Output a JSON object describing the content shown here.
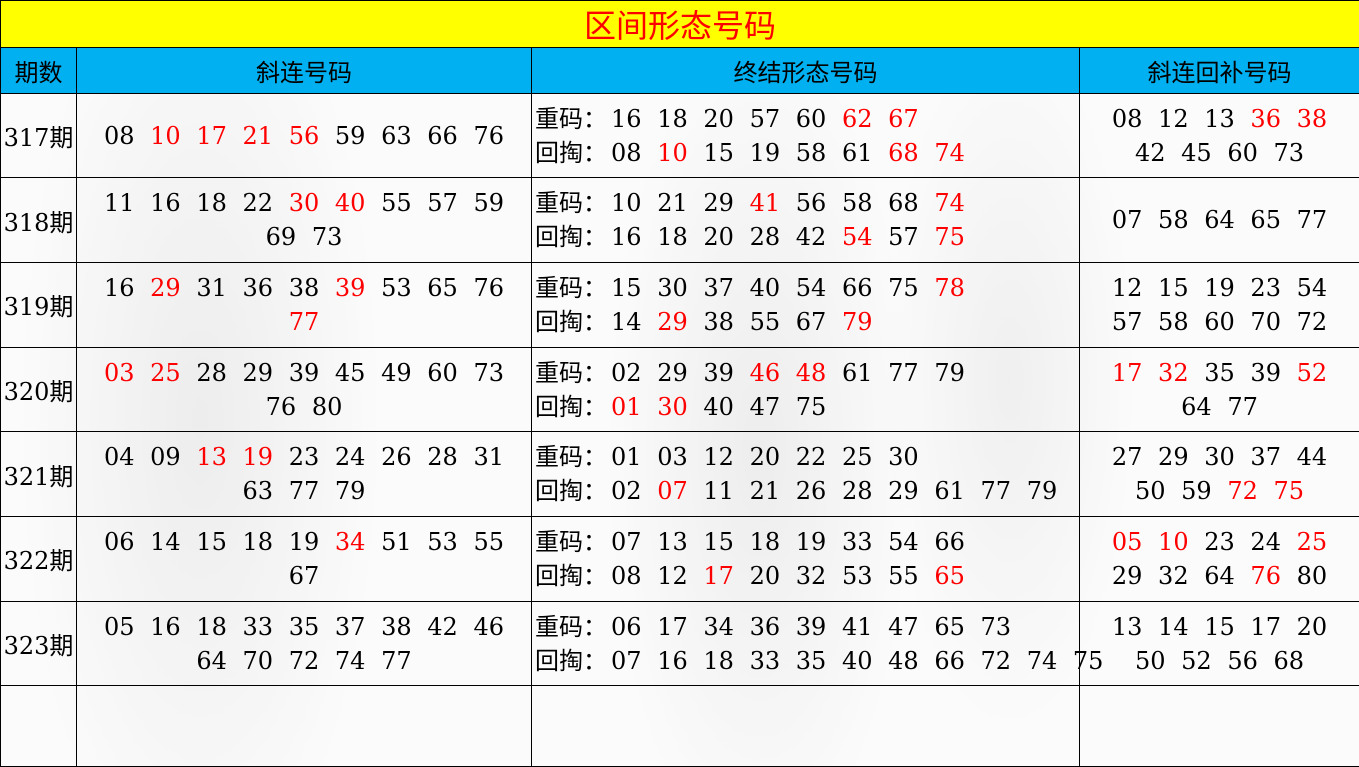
{
  "title": "区间形态号码",
  "headers": {
    "period": "期数",
    "diagonal": "斜连号码",
    "final": "终结形态号码",
    "supplement": "斜连回补号码"
  },
  "labels": {
    "repeat": "重码：",
    "fallback": "回掏："
  },
  "colors": {
    "title_bg": "#ffff00",
    "title_text": "#ff0000",
    "header_bg": "#00b0f0",
    "highlight": "#ff0000"
  },
  "rows": [
    {
      "period": "317期",
      "diagonal": [
        {
          "n": "08"
        },
        {
          "n": "10",
          "hot": true
        },
        {
          "n": "17",
          "hot": true
        },
        {
          "n": "21",
          "hot": true
        },
        {
          "n": "56",
          "hot": true
        },
        {
          "n": "59"
        },
        {
          "n": "63"
        },
        {
          "n": "66"
        },
        {
          "n": "76"
        }
      ],
      "repeat": [
        {
          "n": "16"
        },
        {
          "n": "18"
        },
        {
          "n": "20"
        },
        {
          "n": "57"
        },
        {
          "n": "60"
        },
        {
          "n": "62",
          "hot": true
        },
        {
          "n": "67",
          "hot": true
        }
      ],
      "fallback": [
        {
          "n": "08"
        },
        {
          "n": "10",
          "hot": true
        },
        {
          "n": "15"
        },
        {
          "n": "19"
        },
        {
          "n": "58"
        },
        {
          "n": "61"
        },
        {
          "n": "68",
          "hot": true
        },
        {
          "n": "74",
          "hot": true
        }
      ],
      "supplement": [
        {
          "n": "08"
        },
        {
          "n": "12"
        },
        {
          "n": "13"
        },
        {
          "n": "36",
          "hot": true
        },
        {
          "n": "38",
          "hot": true
        },
        {
          "n": "42"
        },
        {
          "n": "45"
        },
        {
          "n": "60"
        },
        {
          "n": "73"
        }
      ]
    },
    {
      "period": "318期",
      "diagonal": [
        {
          "n": "11"
        },
        {
          "n": "16"
        },
        {
          "n": "18"
        },
        {
          "n": "22"
        },
        {
          "n": "30",
          "hot": true
        },
        {
          "n": "40",
          "hot": true
        },
        {
          "n": "55"
        },
        {
          "n": "57"
        },
        {
          "n": "59"
        },
        {
          "n": "69"
        },
        {
          "n": "73"
        }
      ],
      "repeat": [
        {
          "n": "10"
        },
        {
          "n": "21"
        },
        {
          "n": "29"
        },
        {
          "n": "41",
          "hot": true
        },
        {
          "n": "56"
        },
        {
          "n": "58"
        },
        {
          "n": "68"
        },
        {
          "n": "74",
          "hot": true
        }
      ],
      "fallback": [
        {
          "n": "16"
        },
        {
          "n": "18"
        },
        {
          "n": "20"
        },
        {
          "n": "28"
        },
        {
          "n": "42"
        },
        {
          "n": "54",
          "hot": true
        },
        {
          "n": "57"
        },
        {
          "n": "75",
          "hot": true
        }
      ],
      "supplement": [
        {
          "n": "07"
        },
        {
          "n": "58"
        },
        {
          "n": "64"
        },
        {
          "n": "65"
        },
        {
          "n": "77"
        }
      ]
    },
    {
      "period": "319期",
      "diagonal": [
        {
          "n": "16"
        },
        {
          "n": "29",
          "hot": true
        },
        {
          "n": "31"
        },
        {
          "n": "36"
        },
        {
          "n": "38"
        },
        {
          "n": "39",
          "hot": true
        },
        {
          "n": "53"
        },
        {
          "n": "65"
        },
        {
          "n": "76"
        },
        {
          "n": "77",
          "hot": true
        }
      ],
      "repeat": [
        {
          "n": "15"
        },
        {
          "n": "30"
        },
        {
          "n": "37"
        },
        {
          "n": "40"
        },
        {
          "n": "54"
        },
        {
          "n": "66"
        },
        {
          "n": "75"
        },
        {
          "n": "78",
          "hot": true
        }
      ],
      "fallback": [
        {
          "n": "14"
        },
        {
          "n": "29",
          "hot": true
        },
        {
          "n": "38"
        },
        {
          "n": "55"
        },
        {
          "n": "67"
        },
        {
          "n": "79",
          "hot": true
        }
      ],
      "supplement": [
        {
          "n": "12"
        },
        {
          "n": "15"
        },
        {
          "n": "19"
        },
        {
          "n": "23"
        },
        {
          "n": "54"
        },
        {
          "n": "57"
        },
        {
          "n": "58"
        },
        {
          "n": "60"
        },
        {
          "n": "70"
        },
        {
          "n": "72"
        }
      ]
    },
    {
      "period": "320期",
      "diagonal": [
        {
          "n": "03",
          "hot": true
        },
        {
          "n": "25",
          "hot": true
        },
        {
          "n": "28"
        },
        {
          "n": "29"
        },
        {
          "n": "39"
        },
        {
          "n": "45"
        },
        {
          "n": "49"
        },
        {
          "n": "60"
        },
        {
          "n": "73"
        },
        {
          "n": "76"
        },
        {
          "n": "80"
        }
      ],
      "repeat": [
        {
          "n": "02"
        },
        {
          "n": "29"
        },
        {
          "n": "39"
        },
        {
          "n": "46",
          "hot": true
        },
        {
          "n": "48",
          "hot": true
        },
        {
          "n": "61"
        },
        {
          "n": "77"
        },
        {
          "n": "79"
        }
      ],
      "fallback": [
        {
          "n": "01",
          "hot": true
        },
        {
          "n": "30",
          "hot": true
        },
        {
          "n": "40"
        },
        {
          "n": "47"
        },
        {
          "n": "75"
        }
      ],
      "supplement": [
        {
          "n": "17",
          "hot": true
        },
        {
          "n": "32",
          "hot": true
        },
        {
          "n": "35"
        },
        {
          "n": "39"
        },
        {
          "n": "52",
          "hot": true
        },
        {
          "n": "64"
        },
        {
          "n": "77"
        }
      ]
    },
    {
      "period": "321期",
      "diagonal": [
        {
          "n": "04"
        },
        {
          "n": "09"
        },
        {
          "n": "13",
          "hot": true
        },
        {
          "n": "19",
          "hot": true
        },
        {
          "n": "23"
        },
        {
          "n": "24"
        },
        {
          "n": "26"
        },
        {
          "n": "28"
        },
        {
          "n": "31"
        },
        {
          "n": "63"
        },
        {
          "n": "77"
        },
        {
          "n": "79"
        }
      ],
      "repeat": [
        {
          "n": "01"
        },
        {
          "n": "03"
        },
        {
          "n": "12"
        },
        {
          "n": "20"
        },
        {
          "n": "22"
        },
        {
          "n": "25"
        },
        {
          "n": "30"
        }
      ],
      "fallback": [
        {
          "n": "02"
        },
        {
          "n": "07",
          "hot": true
        },
        {
          "n": "11"
        },
        {
          "n": "21"
        },
        {
          "n": "26"
        },
        {
          "n": "28"
        },
        {
          "n": "29"
        },
        {
          "n": "61"
        },
        {
          "n": "77"
        },
        {
          "n": "79"
        }
      ],
      "supplement": [
        {
          "n": "27"
        },
        {
          "n": "29"
        },
        {
          "n": "30"
        },
        {
          "n": "37"
        },
        {
          "n": "44"
        },
        {
          "n": "50"
        },
        {
          "n": "59"
        },
        {
          "n": "72",
          "hot": true
        },
        {
          "n": "75",
          "hot": true
        }
      ]
    },
    {
      "period": "322期",
      "diagonal": [
        {
          "n": "06"
        },
        {
          "n": "14"
        },
        {
          "n": "15"
        },
        {
          "n": "18"
        },
        {
          "n": "19"
        },
        {
          "n": "34",
          "hot": true
        },
        {
          "n": "51"
        },
        {
          "n": "53"
        },
        {
          "n": "55"
        },
        {
          "n": "67"
        }
      ],
      "repeat": [
        {
          "n": "07"
        },
        {
          "n": "13"
        },
        {
          "n": "15"
        },
        {
          "n": "18"
        },
        {
          "n": "19"
        },
        {
          "n": "33"
        },
        {
          "n": "54"
        },
        {
          "n": "66"
        }
      ],
      "fallback": [
        {
          "n": "08"
        },
        {
          "n": "12"
        },
        {
          "n": "17",
          "hot": true
        },
        {
          "n": "20"
        },
        {
          "n": "32"
        },
        {
          "n": "53"
        },
        {
          "n": "55"
        },
        {
          "n": "65",
          "hot": true
        }
      ],
      "supplement": [
        {
          "n": "05",
          "hot": true
        },
        {
          "n": "10",
          "hot": true
        },
        {
          "n": "23"
        },
        {
          "n": "24"
        },
        {
          "n": "25",
          "hot": true
        },
        {
          "n": "29"
        },
        {
          "n": "32"
        },
        {
          "n": "64"
        },
        {
          "n": "76",
          "hot": true
        },
        {
          "n": "80"
        }
      ]
    },
    {
      "period": "323期",
      "diagonal": [
        {
          "n": "05"
        },
        {
          "n": "16"
        },
        {
          "n": "18"
        },
        {
          "n": "33"
        },
        {
          "n": "35"
        },
        {
          "n": "37"
        },
        {
          "n": "38"
        },
        {
          "n": "42"
        },
        {
          "n": "46"
        },
        {
          "n": "64"
        },
        {
          "n": "70"
        },
        {
          "n": "72"
        },
        {
          "n": "74"
        },
        {
          "n": "77"
        }
      ],
      "repeat": [
        {
          "n": "06"
        },
        {
          "n": "17"
        },
        {
          "n": "34"
        },
        {
          "n": "36"
        },
        {
          "n": "39"
        },
        {
          "n": "41"
        },
        {
          "n": "47"
        },
        {
          "n": "65"
        },
        {
          "n": "73"
        }
      ],
      "fallback": [
        {
          "n": "07"
        },
        {
          "n": "16"
        },
        {
          "n": "18"
        },
        {
          "n": "33"
        },
        {
          "n": "35"
        },
        {
          "n": "40"
        },
        {
          "n": "48"
        },
        {
          "n": "66"
        },
        {
          "n": "72"
        },
        {
          "n": "74"
        },
        {
          "n": "75"
        }
      ],
      "supplement": [
        {
          "n": "13"
        },
        {
          "n": "14"
        },
        {
          "n": "15"
        },
        {
          "n": "17"
        },
        {
          "n": "20"
        },
        {
          "n": "50"
        },
        {
          "n": "52"
        },
        {
          "n": "56"
        },
        {
          "n": "68"
        }
      ]
    }
  ]
}
